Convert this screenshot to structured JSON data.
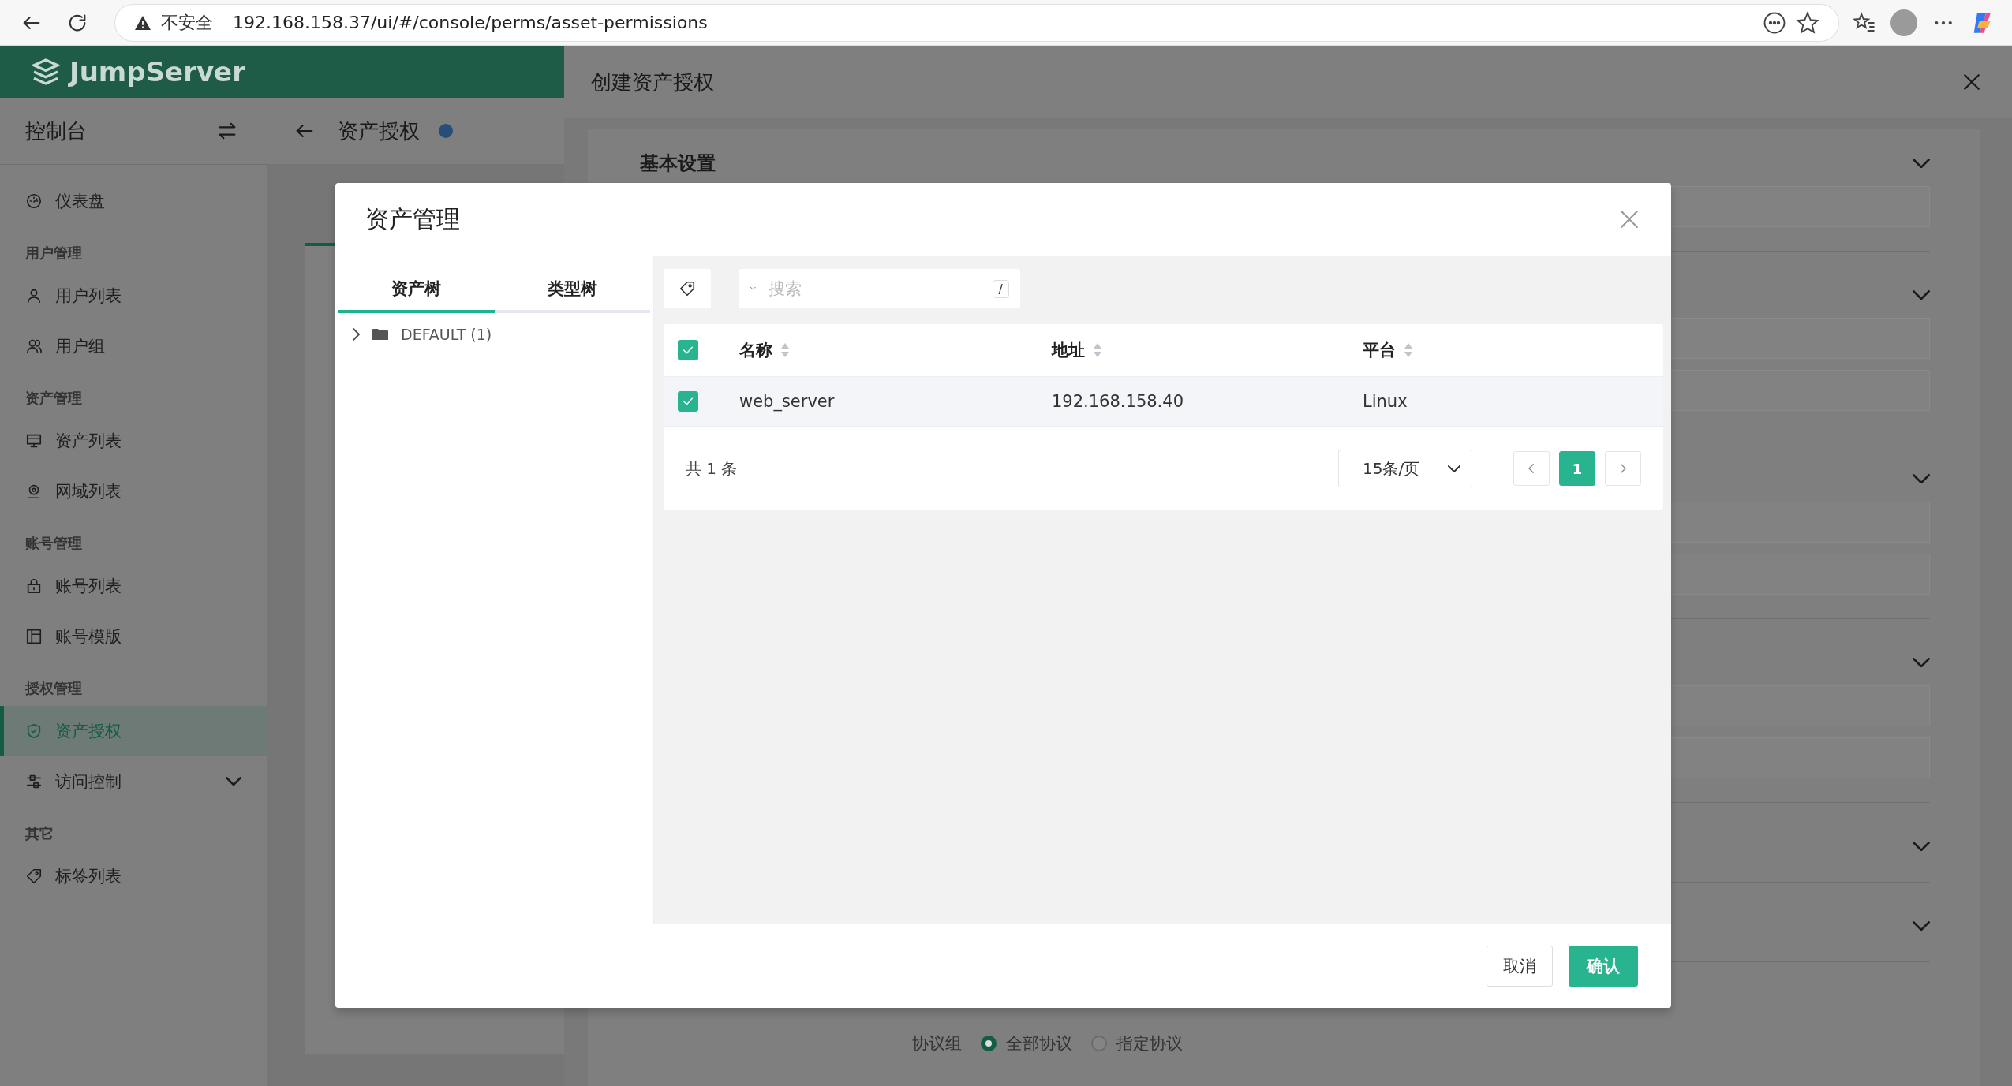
{
  "browser": {
    "security_label": "不安全",
    "url": "192.168.158.37/ui/#/console/perms/asset-permissions"
  },
  "app": {
    "logo": "JumpServer"
  },
  "sidebar": {
    "title": "控制台",
    "groups": [
      {
        "items": [
          {
            "label": "仪表盘",
            "selected": false
          }
        ]
      },
      {
        "heading": "用户管理",
        "items": [
          {
            "label": "用户列表",
            "selected": false
          },
          {
            "label": "用户组",
            "selected": false
          }
        ]
      },
      {
        "heading": "资产管理",
        "items": [
          {
            "label": "资产列表",
            "selected": false
          },
          {
            "label": "网域列表",
            "selected": false
          }
        ]
      },
      {
        "heading": "账号管理",
        "items": [
          {
            "label": "账号列表",
            "selected": false
          },
          {
            "label": "账号模版",
            "selected": false
          }
        ]
      },
      {
        "heading": "授权管理",
        "items": [
          {
            "label": "资产授权",
            "selected": true
          },
          {
            "label": "访问控制",
            "selected": false,
            "expanded": false
          }
        ]
      },
      {
        "heading": "其它",
        "items": [
          {
            "label": "标签列表",
            "selected": false
          }
        ]
      }
    ]
  },
  "page": {
    "title": "资产授权"
  },
  "drawer": {
    "title": "创建资产授权",
    "section_title": "基本设置",
    "protocol": {
      "label": "协议组",
      "options": [
        {
          "label": "全部协议",
          "selected": true
        },
        {
          "label": "指定协议",
          "selected": false
        }
      ]
    }
  },
  "modal": {
    "title": "资产管理",
    "tabs": [
      {
        "label": "资产树",
        "selected": true
      },
      {
        "label": "类型树",
        "selected": false
      }
    ],
    "tree": [
      {
        "label": "DEFAULT (1)",
        "expanded": false
      }
    ],
    "search": {
      "placeholder": "搜索",
      "shortcut": "/"
    },
    "table": {
      "header_checked": true,
      "columns": [
        "名称",
        "地址",
        "平台"
      ],
      "rows": [
        {
          "checked": true,
          "cells": [
            "web_server",
            "192.168.158.40",
            "Linux"
          ]
        }
      ]
    },
    "pagination": {
      "total": "共 1 条",
      "page_size": "15条/页",
      "pages": [
        {
          "label": "1",
          "selected": true
        }
      ]
    },
    "buttons": {
      "cancel": "取消",
      "confirm": "确认"
    }
  }
}
